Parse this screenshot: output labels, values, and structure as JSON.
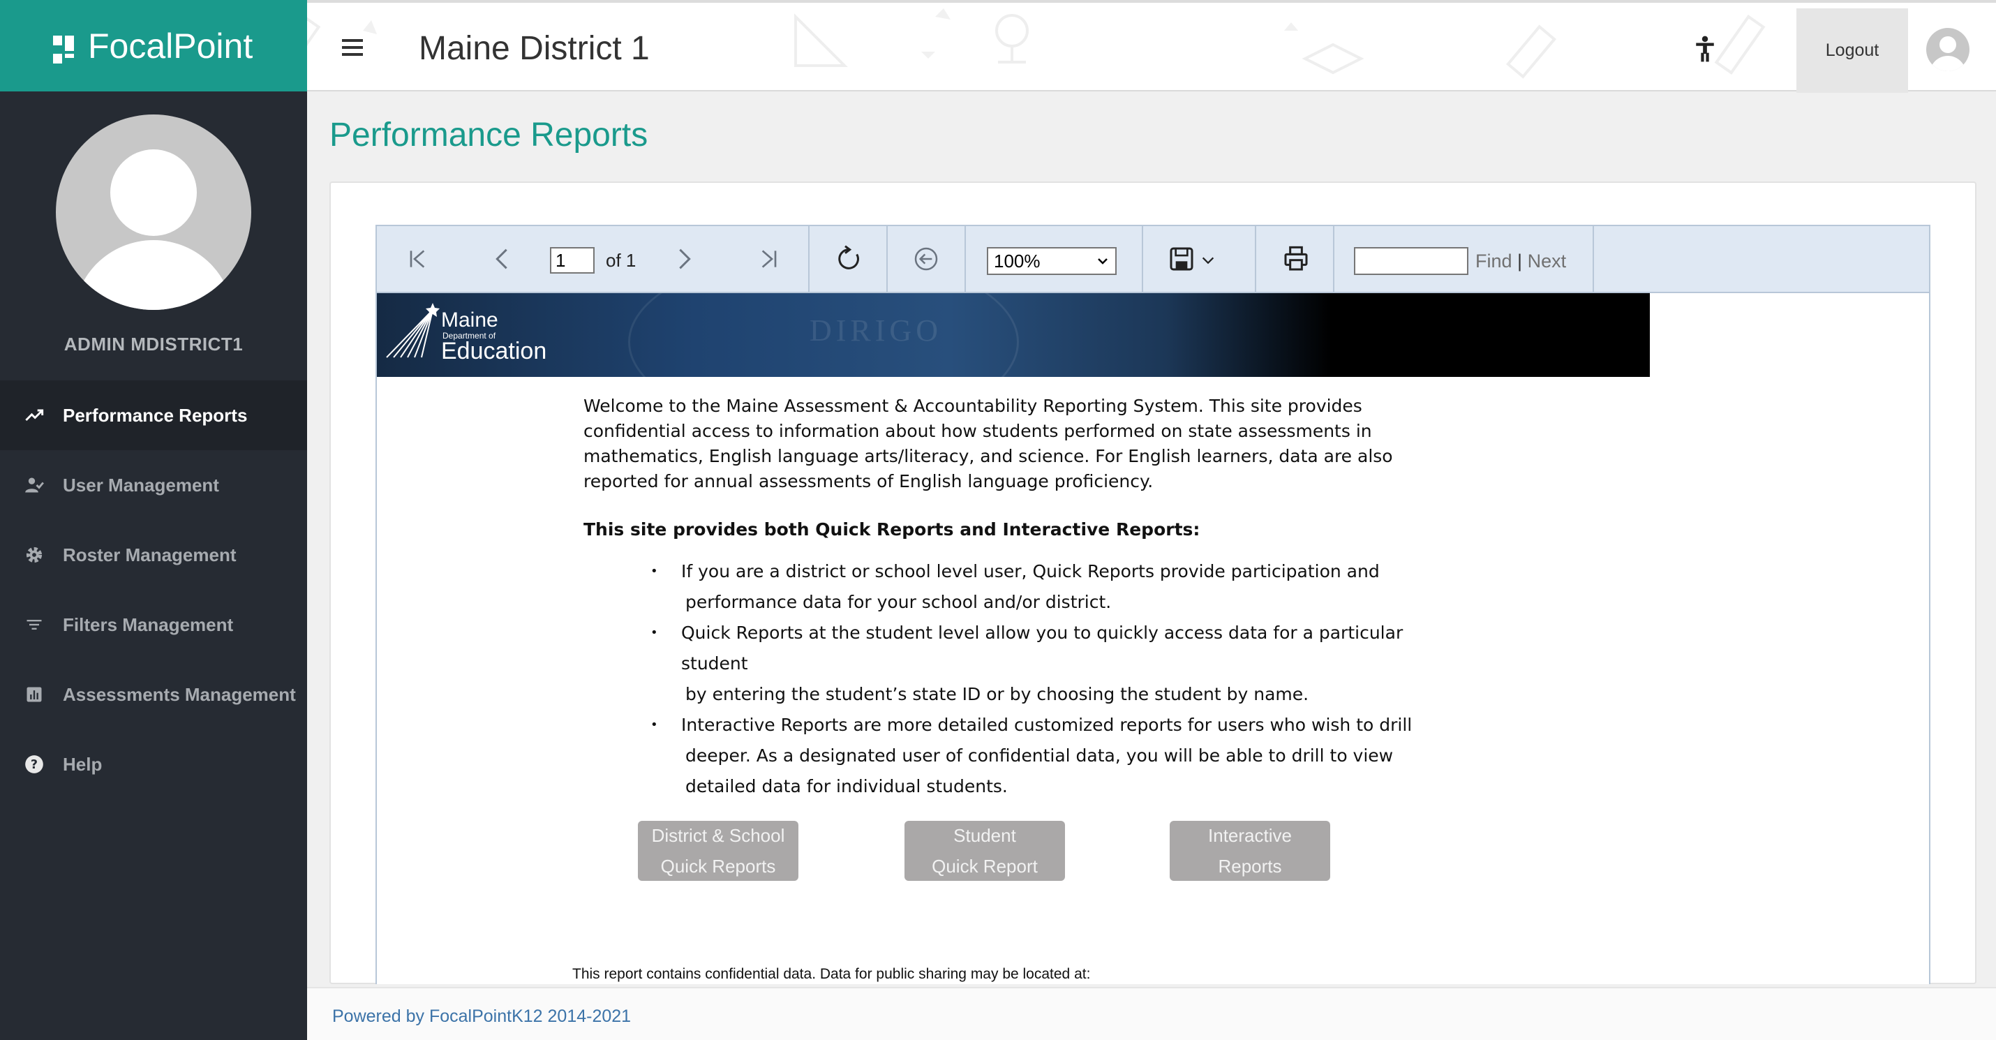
{
  "sidebar": {
    "brand": "FocalPoint",
    "username": "ADMIN MDISTRICT1",
    "items": [
      {
        "label": "Performance Reports",
        "icon": "trending-up-icon",
        "active": true
      },
      {
        "label": "User Management",
        "icon": "user-check-icon",
        "active": false
      },
      {
        "label": "Roster Management",
        "icon": "gear-icon",
        "active": false
      },
      {
        "label": "Filters Management",
        "icon": "filter-icon",
        "active": false
      },
      {
        "label": "Assessments Management",
        "icon": "bar-chart-icon",
        "active": false
      },
      {
        "label": "Help",
        "icon": "help-circle-icon",
        "active": false
      }
    ]
  },
  "header": {
    "district": "Maine District 1",
    "logout_label": "Logout"
  },
  "main": {
    "page_title": "Performance Reports"
  },
  "toolbar": {
    "page_value": "1",
    "page_of": "of 1",
    "zoom_value": "100%",
    "find_label": "Find",
    "separator": "|",
    "next_label": "Next"
  },
  "banner": {
    "logo_line1": "Maine",
    "logo_line2": "Department of",
    "logo_line3": "Education",
    "seal_text": "DIRIGO"
  },
  "report": {
    "intro": "Welcome to the Maine Assessment & Accountability Reporting System.  This site provides confidential access to information about how students performed on state assessments in mathematics, English language arts/literacy, and science.  For English learners, data are also reported for annual assessments of English language proficiency.",
    "subhead": "This site provides both Quick Reports and Interactive Reports:",
    "bullets": [
      {
        "line1": "If you are a district or school level user, Quick Reports provide participation and",
        "line2": "performance data for your school and/or district."
      },
      {
        "line1": "Quick Reports at the student level allow you to quickly access data for a particular student",
        "line2": "by entering the student’s state ID or by choosing the student by name."
      },
      {
        "line1": "Interactive Reports are more detailed customized reports for users who wish to drill",
        "line2": "deeper.  As a designated user of confidential data, you will be able to drill to view",
        "line3": "detailed data for individual students."
      }
    ],
    "buttons": [
      {
        "line1": "District & School",
        "line2": "Quick Reports"
      },
      {
        "line1": "Student",
        "line2": "Quick Report"
      },
      {
        "line1": "Interactive",
        "line2": "Reports"
      }
    ],
    "footer_note": "This report contains confidential data. Data for public sharing may be located at:"
  },
  "footer": {
    "text": "Powered by FocalPointK12 2014-2021"
  },
  "colors": {
    "brand": "#1a9a8c",
    "sidebar": "#262b33",
    "toolbar": "#dfe8f3",
    "report_button": "#aaa8a8"
  }
}
